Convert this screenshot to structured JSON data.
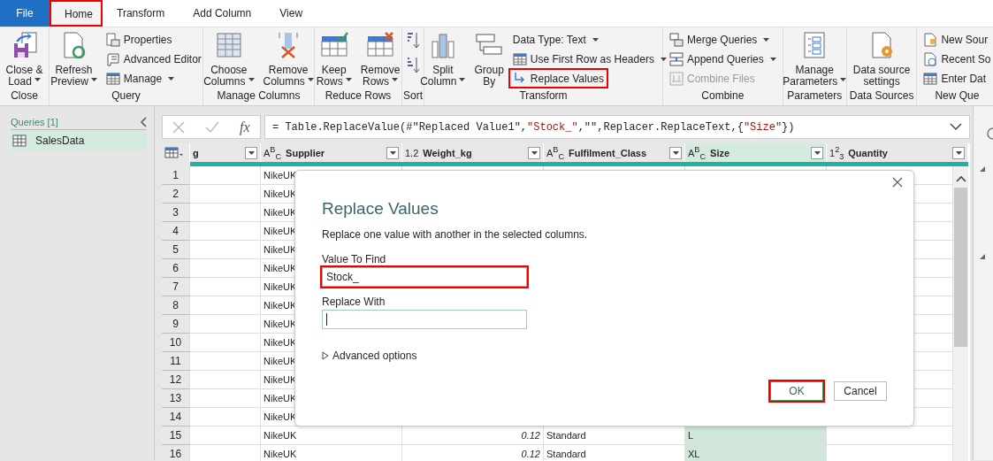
{
  "tabs": [
    {
      "label": "File",
      "kind": "file",
      "selected": false,
      "highlighted": false
    },
    {
      "label": "Home",
      "kind": "tab",
      "selected": true,
      "highlighted": true
    },
    {
      "label": "Transform",
      "kind": "tab",
      "selected": false,
      "highlighted": false
    },
    {
      "label": "Add Column",
      "kind": "tab",
      "selected": false,
      "highlighted": false
    },
    {
      "label": "View",
      "kind": "tab",
      "selected": false,
      "highlighted": false
    }
  ],
  "ribbon": {
    "groups": [
      {
        "label": "Close",
        "buttons": [
          {
            "kind": "large",
            "lines": [
              "Close &",
              "Load"
            ],
            "caret": true
          }
        ]
      },
      {
        "label": "Query",
        "buttons": [
          {
            "kind": "large",
            "lines": [
              "Refresh",
              "Preview"
            ],
            "caret": true
          },
          {
            "kind": "stack",
            "items": [
              {
                "label": "Properties",
                "caret": false,
                "disabled": false,
                "highlighted": false
              },
              {
                "label": "Advanced Editor",
                "caret": false,
                "disabled": false,
                "highlighted": false
              },
              {
                "label": "Manage",
                "caret": true,
                "disabled": false,
                "highlighted": false
              }
            ]
          }
        ]
      },
      {
        "label": "Manage Columns",
        "buttons": [
          {
            "kind": "large",
            "lines": [
              "Choose",
              "Columns"
            ],
            "caret": true
          },
          {
            "kind": "large",
            "lines": [
              "Remove",
              "Columns"
            ],
            "caret": true
          }
        ]
      },
      {
        "label": "Reduce Rows",
        "buttons": [
          {
            "kind": "large",
            "lines": [
              "Keep",
              "Rows"
            ],
            "caret": true
          },
          {
            "kind": "large",
            "lines": [
              "Remove",
              "Rows"
            ],
            "caret": true
          }
        ]
      },
      {
        "label": "Sort",
        "buttons": [
          {
            "kind": "sort"
          }
        ]
      },
      {
        "label": "Transform",
        "buttons": [
          {
            "kind": "large",
            "lines": [
              "Split",
              "Column"
            ],
            "caret": true
          },
          {
            "kind": "large",
            "lines": [
              "Group",
              "By"
            ],
            "caret": false
          },
          {
            "kind": "stack",
            "items": [
              {
                "label": "Data Type: Text",
                "caret": true,
                "disabled": false,
                "highlighted": false
              },
              {
                "label": "Use First Row as Headers",
                "caret": true,
                "disabled": false,
                "highlighted": false
              },
              {
                "label": "Replace Values",
                "caret": false,
                "disabled": false,
                "highlighted": true
              }
            ]
          }
        ]
      },
      {
        "label": "Combine",
        "buttons": [
          {
            "kind": "stack",
            "items": [
              {
                "label": "Merge Queries",
                "caret": true,
                "disabled": false,
                "highlighted": false
              },
              {
                "label": "Append Queries",
                "caret": true,
                "disabled": false,
                "highlighted": false
              },
              {
                "label": "Combine Files",
                "caret": false,
                "disabled": true,
                "highlighted": false
              }
            ]
          }
        ]
      },
      {
        "label": "Parameters",
        "buttons": [
          {
            "kind": "large",
            "lines": [
              "Manage",
              "Parameters"
            ],
            "caret": true
          }
        ]
      },
      {
        "label": "Data Sources",
        "buttons": [
          {
            "kind": "large",
            "lines": [
              "Data source",
              "settings"
            ],
            "caret": false
          }
        ]
      },
      {
        "label": "New Que",
        "buttons": [
          {
            "kind": "stack",
            "items": [
              {
                "label": "New Sour",
                "caret": false,
                "disabled": false,
                "highlighted": false
              },
              {
                "label": "Recent So",
                "caret": false,
                "disabled": false,
                "highlighted": false
              },
              {
                "label": "Enter Dat",
                "caret": false,
                "disabled": false,
                "highlighted": false
              }
            ]
          }
        ]
      }
    ]
  },
  "queries": {
    "header": "Queries [1]",
    "items": [
      {
        "label": "SalesData",
        "selected": true
      }
    ]
  },
  "formula_bar": {
    "fx": "fx",
    "parts": [
      {
        "kind": "code",
        "text": "= Table.ReplaceValue(#\"Replaced Value1\","
      },
      {
        "kind": "string",
        "text": "\"Stock_\""
      },
      {
        "kind": "code",
        "text": ",\"\",Replacer.ReplaceText,{"
      },
      {
        "kind": "string",
        "text": "\"Size\""
      },
      {
        "kind": "code",
        "text": "})"
      }
    ]
  },
  "grid": {
    "columns": [
      {
        "name": "g",
        "selected": false
      },
      {
        "name": "Supplier",
        "type_label": "A$^{B}$$_{C}$",
        "selected": false
      },
      {
        "name": "Weight_kg",
        "type_label": "1.2",
        "selected": false
      },
      {
        "name": "Fulfilment_Class",
        "type_label": "A$^{B}$$_{C}$",
        "selected": false
      },
      {
        "name": "Size",
        "type_label": "A$^{B}$$_{C}$",
        "selected": true
      },
      {
        "name": "Quantity",
        "type_label": "1$^{2}$$_{3}$",
        "selected": false
      }
    ],
    "rows": [
      {
        "number": "1",
        "supplier": "NikeUK"
      },
      {
        "number": "2",
        "supplier": "NikeUK"
      },
      {
        "number": "3",
        "supplier": "NikeUK"
      },
      {
        "number": "4",
        "supplier": "NikeUK"
      },
      {
        "number": "5",
        "supplier": "NikeUK"
      },
      {
        "number": "6",
        "supplier": "NikeUK"
      },
      {
        "number": "7",
        "supplier": "NikeUK"
      },
      {
        "number": "8",
        "supplier": "NikeUK"
      },
      {
        "number": "9",
        "supplier": "NikeUK"
      },
      {
        "number": "10",
        "supplier": "NikeUK"
      },
      {
        "number": "11",
        "supplier": "NikeUK"
      },
      {
        "number": "12",
        "supplier": "NikeUK"
      },
      {
        "number": "13",
        "supplier": "NikeUK"
      },
      {
        "number": "14",
        "supplier": "NikeUK"
      },
      {
        "number": "15",
        "supplier": "NikeUK",
        "weight_kg": "0.12",
        "fulfilment_class": "Standard",
        "size": "L"
      },
      {
        "number": "16",
        "supplier": "NikeUK",
        "weight_kg": "0.12",
        "fulfilment_class": "Standard",
        "size": "XL"
      }
    ]
  },
  "dialog": {
    "title": "Replace Values",
    "description": "Replace one value with another in the selected columns.",
    "fields": [
      {
        "label": "Value To Find",
        "value": "Stock_",
        "focused": false,
        "highlighted": true
      },
      {
        "label": "Replace With",
        "focused": true,
        "highlighted": false
      }
    ],
    "advanced": {
      "label": "Advanced options",
      "expanded": false
    },
    "buttons": [
      {
        "label": "OK",
        "primary": true,
        "highlighted": true
      },
      {
        "label": "Cancel",
        "primary": false,
        "highlighted": false
      }
    ]
  }
}
